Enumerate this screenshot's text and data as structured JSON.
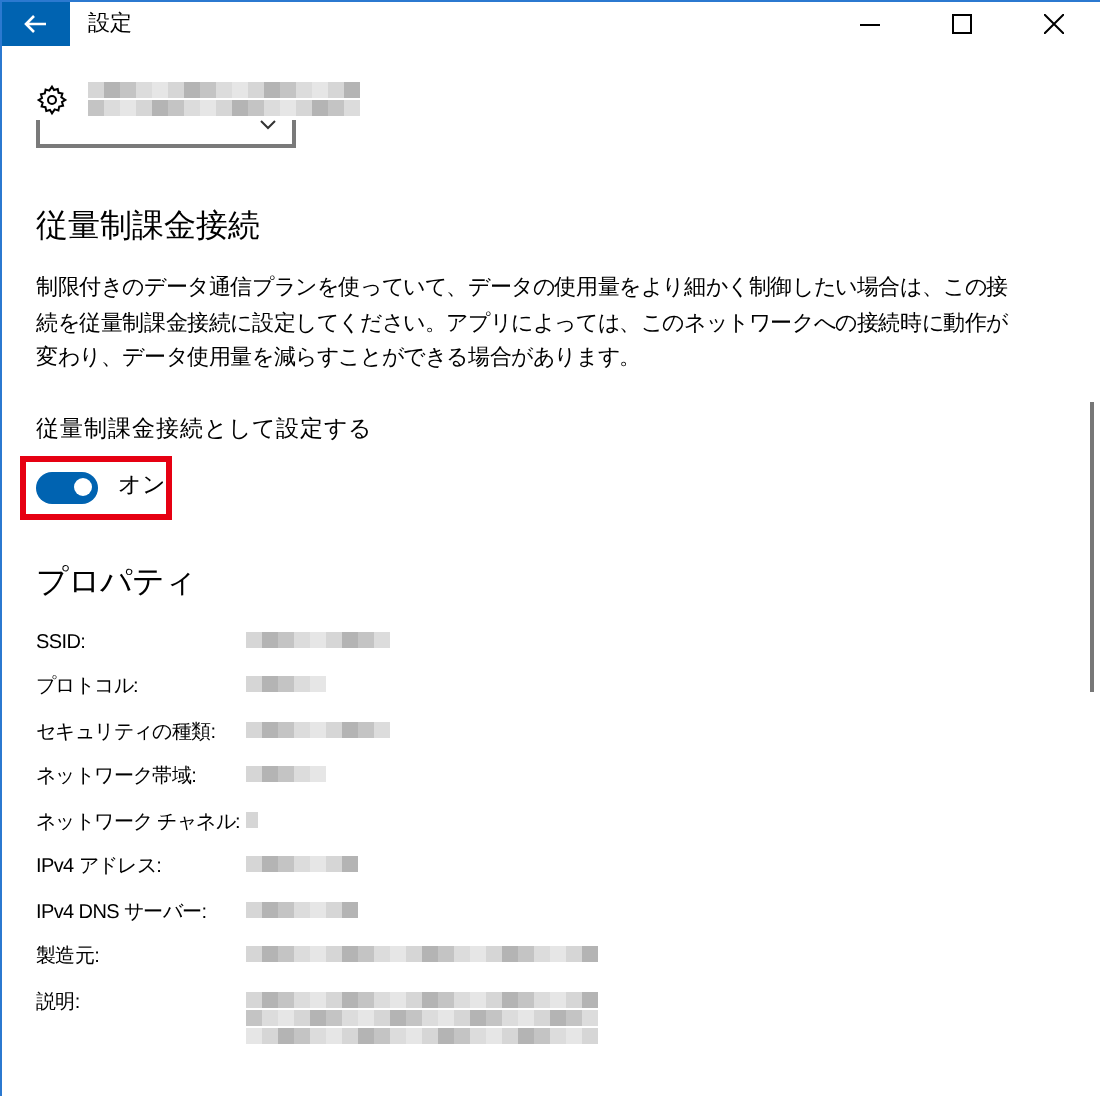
{
  "window": {
    "title": "設定"
  },
  "metered": {
    "heading": "従量制課金接続",
    "description": "制限付きのデータ通信プランを使っていて、データの使用量をより細かく制御したい場合は、この接続を従量制課金接続に設定してください。アプリによっては、このネットワークへの接続時に動作が変わり、データ使用量を減らすことができる場合があります。",
    "toggle": {
      "label": "従量制課金接続として設定する",
      "on": true,
      "state_text": "オン"
    }
  },
  "properties": {
    "heading": "プロパティ",
    "rows": [
      {
        "label": "SSID:"
      },
      {
        "label": "プロトコル:"
      },
      {
        "label": "セキュリティの種類:"
      },
      {
        "label": "ネットワーク帯域:"
      },
      {
        "label": "ネットワーク チャネル:"
      },
      {
        "label": "IPv4 アドレス:"
      },
      {
        "label": "IPv4 DNS サーバー:"
      },
      {
        "label": "製造元:"
      },
      {
        "label": "説明:"
      }
    ]
  }
}
